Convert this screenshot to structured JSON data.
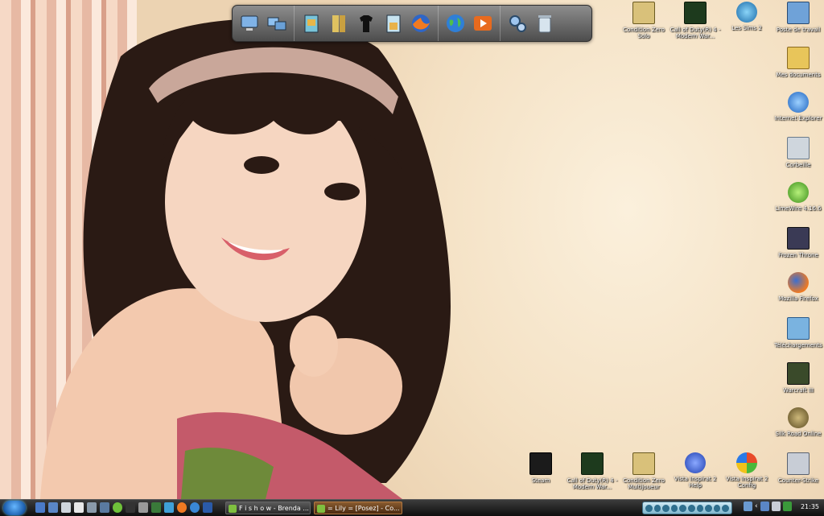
{
  "desktop": {
    "icons_right_column": [
      {
        "label": "Condition Zero Solo",
        "icon": "counter-strike-cz-icon",
        "color": "#d9c17a"
      },
      {
        "label": "Call of Duty(R) 4 - Modern War...",
        "icon": "call-of-duty-icon",
        "color": "#1d3a1d"
      },
      {
        "label": "Les Sims 2",
        "icon": "sims-plumbob-icon",
        "color": "#3fa0d8"
      },
      {
        "label": "Poste de travail",
        "icon": "computer-icon",
        "color": "#6fa2d8"
      },
      {
        "label": "Mes documents",
        "icon": "documents-folder-icon",
        "color": "#e8c55a"
      },
      {
        "label": "Internet Explorer",
        "icon": "internet-explorer-icon",
        "color": "#3a87d6"
      },
      {
        "label": "Corbeille",
        "icon": "recycle-bin-icon",
        "color": "#cfd6dd"
      },
      {
        "label": "LimeWire 4.16.6",
        "icon": "limewire-icon",
        "color": "#6fc23a"
      },
      {
        "label": "Frozen Throne",
        "icon": "frozen-throne-icon",
        "color": "#3a3a55"
      },
      {
        "label": "Mozilla Firefox",
        "icon": "firefox-icon",
        "color": "#e8762a"
      },
      {
        "label": "Téléchargements",
        "icon": "downloads-folder-icon",
        "color": "#7ab3e0"
      },
      {
        "label": "Warcraft III",
        "icon": "warcraft-icon",
        "color": "#3a4a2a"
      },
      {
        "label": "Silk Road Online",
        "icon": "silkroad-icon",
        "color": "#7a6a3a"
      }
    ],
    "icons_bottom_row": [
      {
        "label": "Steam",
        "icon": "steam-icon",
        "color": "#1b1b1b"
      },
      {
        "label": "Call of Duty(R) 4 - Modern War...",
        "icon": "call-of-duty-icon",
        "color": "#1d3a1d"
      },
      {
        "label": "Condition Zero Multijoueur",
        "icon": "counter-strike-cz-icon",
        "color": "#d9c17a"
      },
      {
        "label": "Vista Inspirat 2 Help",
        "icon": "help-icon",
        "color": "#2f55c8"
      },
      {
        "label": "Vista Inspirat 2 Config",
        "icon": "windows-flag-icon",
        "color": "#e8efff"
      },
      {
        "label": "Counter-Strike",
        "icon": "counter-strike-icon",
        "color": "#c8cdd6"
      }
    ]
  },
  "dock": {
    "groups": [
      [
        "computer-icon",
        "network-icon"
      ],
      [
        "folder-pictures-icon",
        "folder-library-icon",
        "tshirt-icon",
        "documents-folder-icon",
        "firefox-icon"
      ],
      [
        "globe-icon",
        "media-player-icon"
      ],
      [
        "settings-gears-icon",
        "recycle-bin-icon"
      ]
    ]
  },
  "taskbar": {
    "tasks": [
      {
        "label": "F i s h o w  - Brenda ..."
      },
      {
        "label": "= Lily = [Posez] - Co..."
      }
    ],
    "clock": "21:35"
  },
  "colors": {
    "taskbar": "#111111",
    "dock": "#6a6a6a",
    "active_task": "#7a4a20"
  }
}
